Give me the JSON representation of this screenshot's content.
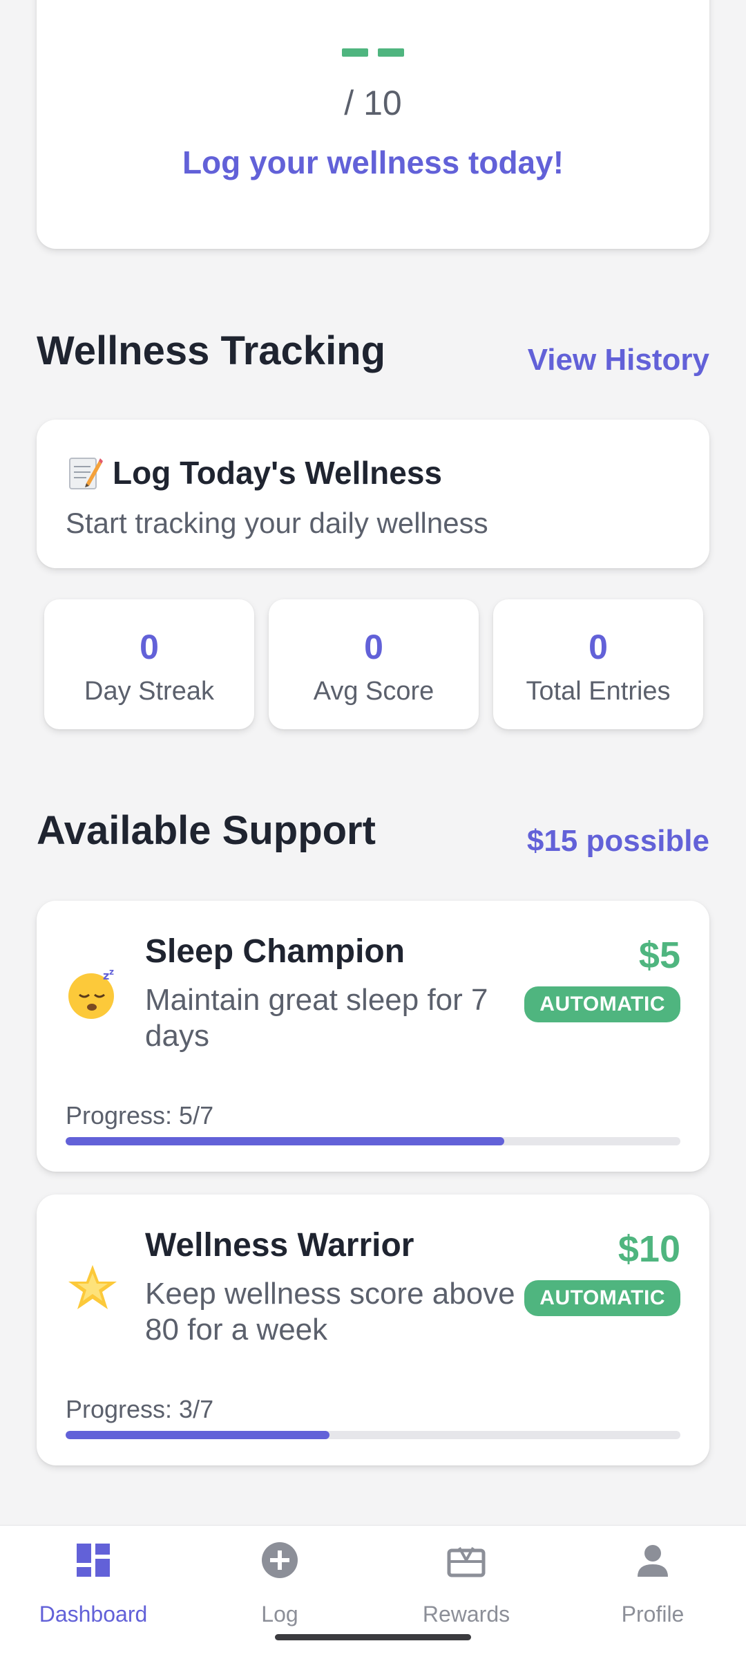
{
  "score_card": {
    "value": "--",
    "denominator": "/ 10",
    "cta": "Log your wellness today!"
  },
  "wellness_tracking": {
    "title": "Wellness Tracking",
    "link": "View History",
    "log_card": {
      "icon": "memo-icon",
      "title": "Log Today's Wellness",
      "subtitle": "Start tracking your daily wellness"
    },
    "stats": [
      {
        "value": "0",
        "label": "Day Streak"
      },
      {
        "value": "0",
        "label": "Avg Score"
      },
      {
        "value": "0",
        "label": "Total Entries"
      }
    ]
  },
  "available_support": {
    "title": "Available Support",
    "possible": "$15 possible",
    "items": [
      {
        "icon": "sleeping-face-icon",
        "title": "Sleep Champion",
        "description": "Maintain great sleep for 7 days",
        "amount": "$5",
        "badge": "AUTOMATIC",
        "progress_label": "Progress: 5/7",
        "progress": 0.714
      },
      {
        "icon": "star-icon",
        "title": "Wellness Warrior",
        "description": "Keep wellness score above 80 for a week",
        "amount": "$10",
        "badge": "AUTOMATIC",
        "progress_label": "Progress: 3/7",
        "progress": 0.429
      }
    ]
  },
  "bottom_nav": {
    "items": [
      {
        "label": "Dashboard",
        "icon": "dashboard-icon",
        "active": true
      },
      {
        "label": "Log",
        "icon": "add-circle-icon",
        "active": false
      },
      {
        "label": "Rewards",
        "icon": "gift-card-icon",
        "active": false
      },
      {
        "label": "Profile",
        "icon": "person-icon",
        "active": false
      }
    ]
  },
  "colors": {
    "accent": "#6261d8",
    "success": "#4fb57f",
    "text": "#1f2430",
    "muted": "#5b606c",
    "background": "#f4f4f5"
  }
}
